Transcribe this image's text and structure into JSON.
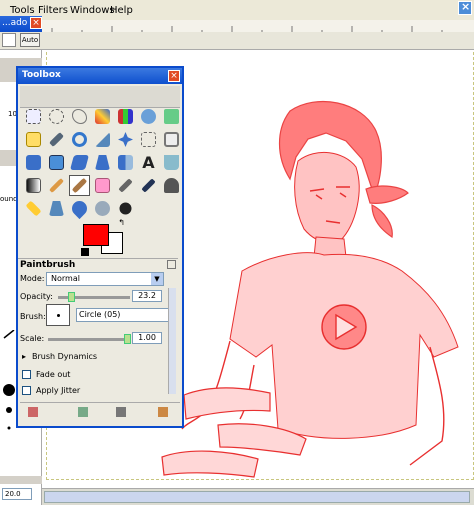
{
  "menubar": {
    "items": [
      "Tools",
      "Filters",
      "Windows",
      "Help"
    ]
  },
  "left_panel": {
    "title": "...ado - ...",
    "auto_label": "Auto",
    "size_value": "20.0",
    "field_value": "10",
    "fragment": "ound"
  },
  "toolbox": {
    "title": "Toolbox",
    "tool_icons": [
      "rect-select-icon",
      "ellipse-select-icon",
      "lasso-icon",
      "fuzzy-select-icon",
      "color-select-icon",
      "scissors-icon",
      "foreground-select-icon",
      "paths-icon",
      "color-picker-icon",
      "zoom-icon",
      "measure-icon",
      "move-icon",
      "align-icon",
      "crop-icon",
      "rotate-icon",
      "scale-icon",
      "shear-icon",
      "perspective-icon",
      "flip-icon",
      "text-icon",
      "bucket-fill-icon",
      "blend-icon",
      "pencil-icon",
      "paintbrush-icon",
      "eraser-icon",
      "airbrush-icon",
      "ink-icon",
      "clone-icon",
      "heal-icon",
      "perspective-clone-icon",
      "blur-icon",
      "smudge-icon",
      "dodge-burn-icon"
    ],
    "active_tool": "paintbrush-icon",
    "colors": {
      "foreground": "#ff0000",
      "background": "#ffffff"
    }
  },
  "tool_options": {
    "title": "Paintbrush",
    "mode_label": "Mode:",
    "mode_value": "Normal",
    "opacity_label": "Opacity:",
    "opacity_value": "23.2",
    "brush_label": "Brush:",
    "brush_value": "Circle (05)",
    "scale_label": "Scale:",
    "scale_value": "1.00",
    "brush_dynamics": "Brush Dynamics",
    "fade_out": "Fade out",
    "apply_jitter": "Apply Jitter"
  }
}
